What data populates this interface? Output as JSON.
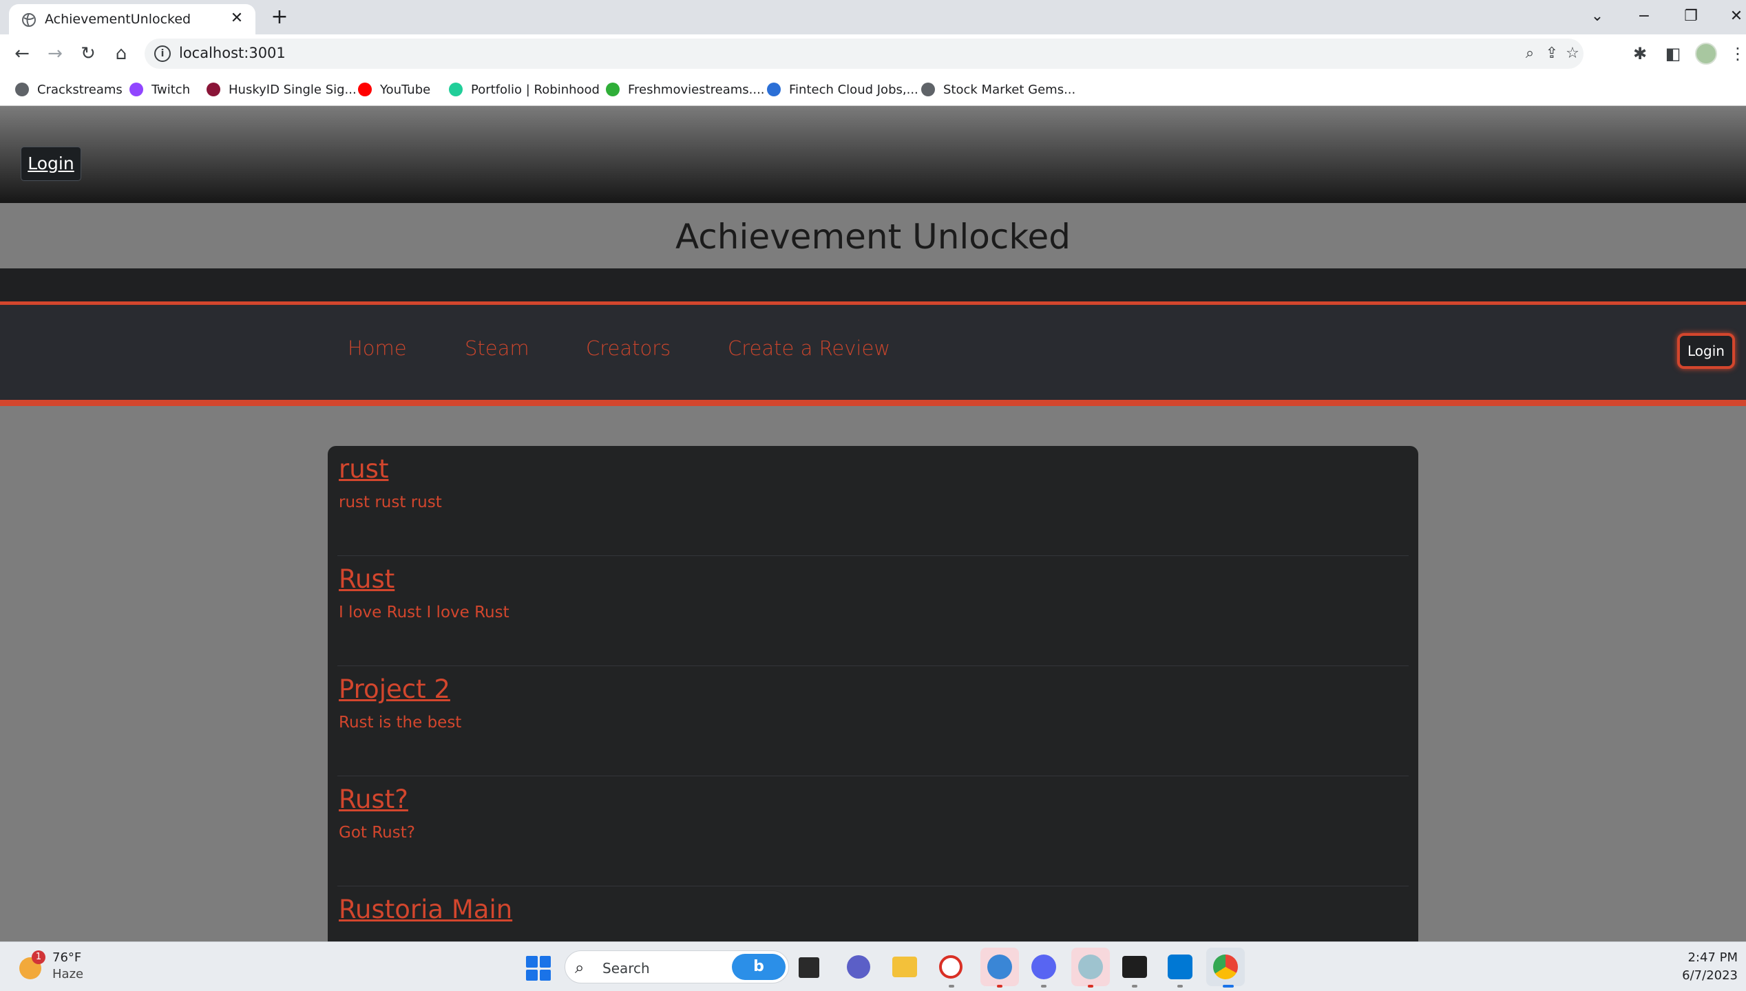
{
  "browser": {
    "tab_title": "AchievementUnlocked",
    "tab_close": "✕",
    "new_tab": "+",
    "url": "localhost:3001",
    "bookmarks": [
      {
        "label": "Crackstreams",
        "color": "#5f6368"
      },
      {
        "label": "Twitch",
        "color": "#9146ff"
      },
      {
        "label": "HuskyID Single Sig...",
        "color": "#8a1538"
      },
      {
        "label": "YouTube",
        "color": "#ff0000"
      },
      {
        "label": "Portfolio | Robinhood",
        "color": "#21ce99"
      },
      {
        "label": "Freshmoviestreams....",
        "color": "#2fae38"
      },
      {
        "label": "Fintech Cloud Jobs,...",
        "color": "#2b6fd6"
      },
      {
        "label": "Stock Market Gems...",
        "color": "#5f6368"
      }
    ]
  },
  "page": {
    "top_login": "Login",
    "site_title": "Achievement Unlocked",
    "nav": [
      "Home",
      "Steam",
      "Creators",
      "Create a Review"
    ],
    "nav_login": "Login",
    "accent_color": "#d3462d",
    "reviews": [
      {
        "title": "rust",
        "body": "rust rust rust"
      },
      {
        "title": "Rust",
        "body": "I love Rust I love Rust"
      },
      {
        "title": "Project 2",
        "body": "Rust is the best"
      },
      {
        "title": "Rust?",
        "body": "Got Rust?"
      },
      {
        "title": "Rustoria Main",
        "body": ""
      }
    ]
  },
  "taskbar": {
    "weather_temp": "76°F",
    "weather_cond": "Haze",
    "weather_badge": "1",
    "search_label": "Search",
    "bing": "b",
    "time": "2:47 PM",
    "date": "6/7/2023"
  }
}
